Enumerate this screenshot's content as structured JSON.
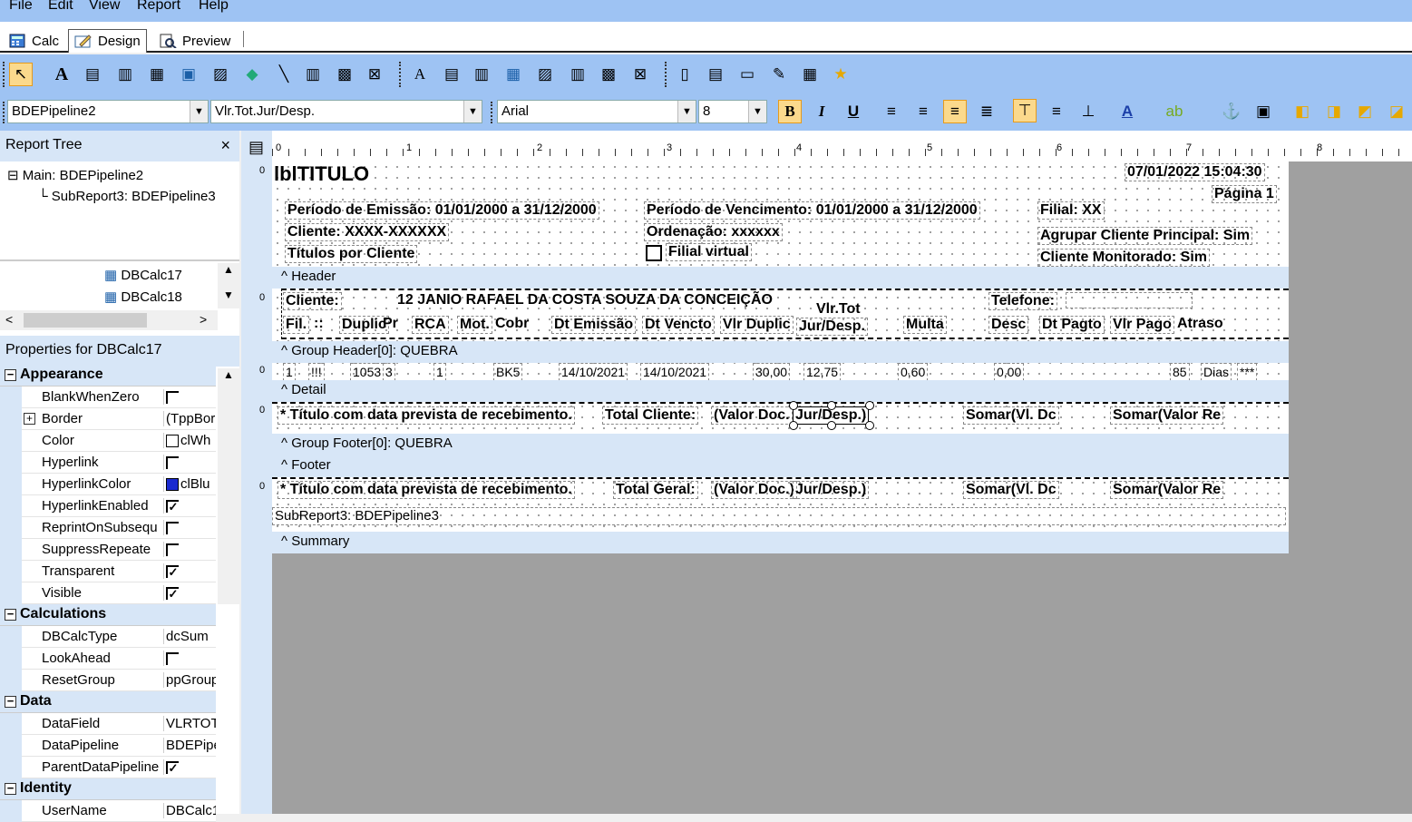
{
  "menu": [
    "File",
    "Edit",
    "View",
    "Report",
    "Help"
  ],
  "tabs": [
    "Calc",
    "Design",
    "Preview"
  ],
  "toolbar2": {
    "pipeline": "BDEPipeline2",
    "field": "Vlr.Tot.Jur/Desp.",
    "font": "Arial",
    "size": "8"
  },
  "report_tree": {
    "title": "Report Tree",
    "close": "×",
    "nodes": [
      "Main: BDEPipeline2",
      "SubReport3: BDEPipeline3"
    ],
    "components": [
      "DBCalc17",
      "DBCalc18"
    ]
  },
  "properties": {
    "title": "Properties for DBCalc17",
    "categories": [
      {
        "name": "Appearance",
        "rows": [
          {
            "name": "BlankWhenZero",
            "value": ""
          },
          {
            "name": "Border",
            "value": "(TppBor"
          },
          {
            "name": "Color",
            "value": "clWh"
          },
          {
            "name": "Hyperlink",
            "value": ""
          },
          {
            "name": "HyperlinkColor",
            "value": "clBlu"
          },
          {
            "name": "HyperlinkEnabled",
            "value": "✓"
          },
          {
            "name": "ReprintOnSubsequ",
            "value": ""
          },
          {
            "name": "SuppressRepeate",
            "value": ""
          },
          {
            "name": "Transparent",
            "value": "✓"
          },
          {
            "name": "Visible",
            "value": "✓"
          }
        ]
      },
      {
        "name": "Calculations",
        "rows": [
          {
            "name": "DBCalcType",
            "value": "dcSum"
          },
          {
            "name": "LookAhead",
            "value": ""
          },
          {
            "name": "ResetGroup",
            "value": "ppGroup"
          }
        ]
      },
      {
        "name": "Data",
        "rows": [
          {
            "name": "DataField",
            "value": "VLRTOT"
          },
          {
            "name": "DataPipeline",
            "value": "BDEPipe"
          },
          {
            "name": "ParentDataPipeline",
            "value": "✓"
          }
        ]
      },
      {
        "name": "Identity",
        "rows": [
          {
            "name": "UserName",
            "value": "DBCalc1"
          }
        ]
      }
    ]
  },
  "ruler": [
    "0",
    "1",
    "2",
    "3",
    "4",
    "5",
    "6",
    "7",
    "8"
  ],
  "report": {
    "title_label": "lblTITULO",
    "datetime": "07/01/2022 15:04:30",
    "page": "Página 1",
    "periodo_emissao": "Período de Emissão: 01/01/2000 a 31/12/2000",
    "periodo_vencimento": "Período de Vencimento: 01/01/2000 a 31/12/2000",
    "filial": "Filial: XX",
    "cliente": "Cliente: XXXX-XXXXXX",
    "ordenacao": "Ordenação: xxxxxx",
    "titulos": "Títulos por Cliente",
    "filial_virtual": "Filial virtual",
    "agrupar": "Agrupar Cliente Principal: Sim",
    "monitorado": "Cliente Monitorado: Sim",
    "bands": {
      "header": "^ Header",
      "group_header": "^ Group Header[0]: QUEBRA",
      "detail": "^ Detail",
      "group_footer": "^ Group Footer[0]: QUEBRA",
      "footer": "^ Footer",
      "summary": "^ Summary"
    },
    "gh": {
      "cliente": "Cliente:",
      "cliente_nome": "12 JANIO RAFAEL DA COSTA SOUZA DA CONCEIÇÃO",
      "vlr_tot": "Vlr.Tot",
      "jur_desp": "Jur/Desp.",
      "telefone": "Telefone:",
      "cols": [
        "Fil.",
        "::",
        "Duplic",
        "Pr",
        "RCA",
        "Mot.",
        "Cobr",
        "Dt Emissão",
        "Dt Vencto",
        "Vlr Duplic",
        "Multa",
        "Desc",
        "Dt Pagto",
        "Vlr Pago",
        "Atraso"
      ]
    },
    "detail": [
      "1",
      "!!!",
      "1053",
      "3",
      "1",
      "BK5",
      "14/10/2021",
      "14/10/2021",
      "30,00",
      "12,75",
      "0,60",
      "0,00",
      "85",
      "Dias",
      "***"
    ],
    "gf": {
      "nota": "* Título com data prevista  de recebimento.",
      "total": "Total Cliente:",
      "valor": "(Valor Doc.",
      "jur": "Jur/Desp.)",
      "somar1": "Somar(Vl. Dc",
      "somar2": "Somar(Valor Re"
    },
    "footer": {
      "nota": "* Título com data prevista  de recebimento.",
      "total": "Total Geral:",
      "valor": "(Valor Doc.)",
      "jur": "Jur/Desp.)",
      "somar1": "Somar(Vl. Dc",
      "somar2": "Somar(Valor Re",
      "subreport": "SubReport3: BDEPipeline3"
    }
  }
}
